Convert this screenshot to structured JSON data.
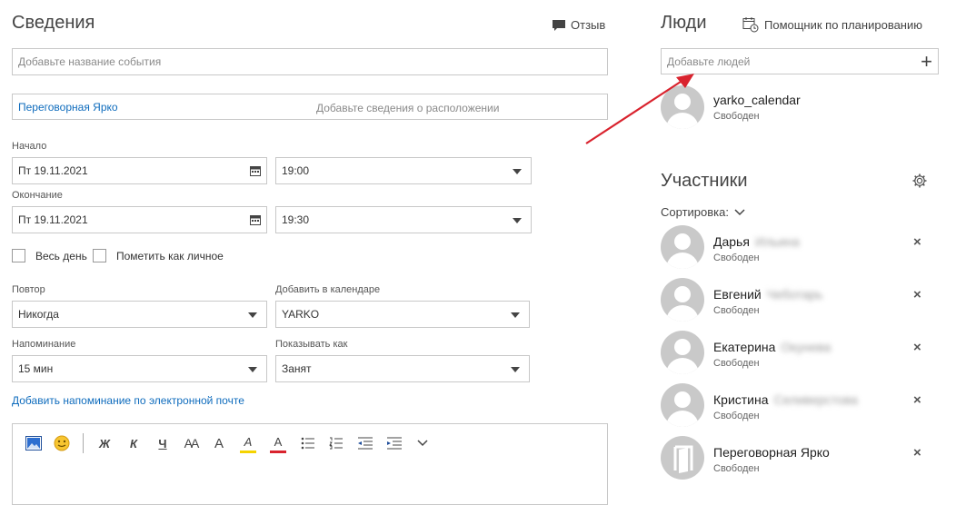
{
  "details": {
    "title": "Сведения",
    "feedback": "Отзыв",
    "event_name_placeholder": "Добавьте название события",
    "location_room": "Переговорная Ярко",
    "location_placeholder": "Добавьте сведения о расположении",
    "start_label": "Начало",
    "start_date": "Пт 19.11.2021",
    "start_time": "19:00",
    "end_label": "Окончание",
    "end_date": "Пт 19.11.2021",
    "end_time": "19:30",
    "all_day": "Весь день",
    "private": "Пометить как личное",
    "repeat_label": "Повтор",
    "repeat_value": "Никогда",
    "calendar_label": "Добавить в календаре",
    "calendar_value": "YARKO",
    "reminder_label": "Напоминание",
    "reminder_value": "15 мин",
    "show_as_label": "Показывать как",
    "show_as_value": "Занят",
    "email_reminder_link": "Добавить напоминание по электронной почте"
  },
  "toolbar": {
    "bold": "Ж",
    "italic": "К",
    "underline": "Ч",
    "font_size": "AA",
    "grow": "A",
    "highlight": "A",
    "font_color": "A"
  },
  "people": {
    "title": "Люди",
    "scheduler": "Помощник по планированию",
    "add_placeholder": "Добавьте людей",
    "add_icon": "+",
    "organizer_name": "yarko_calendar",
    "organizer_status": "Свободен"
  },
  "attendees": {
    "title": "Участники",
    "sort_label": "Сортировка:",
    "items": [
      {
        "first": "Дарья",
        "last": "Ильина",
        "status": "Свободен",
        "remove": "×"
      },
      {
        "first": "Евгений",
        "last": "Чеботарь",
        "status": "Свободен",
        "remove": "×"
      },
      {
        "first": "Екатерина",
        "last": "Окунева",
        "status": "Свободен",
        "remove": "×"
      },
      {
        "first": "Кристина",
        "last": "Селиверстова",
        "status": "Свободен",
        "remove": "×"
      },
      {
        "first": "Переговорная Ярко",
        "last": "",
        "status": "Свободен",
        "remove": "×"
      }
    ]
  },
  "colors": {
    "link": "#0f6cbd",
    "arrow": "#d9232e",
    "avatar": "#c9c9c9"
  }
}
